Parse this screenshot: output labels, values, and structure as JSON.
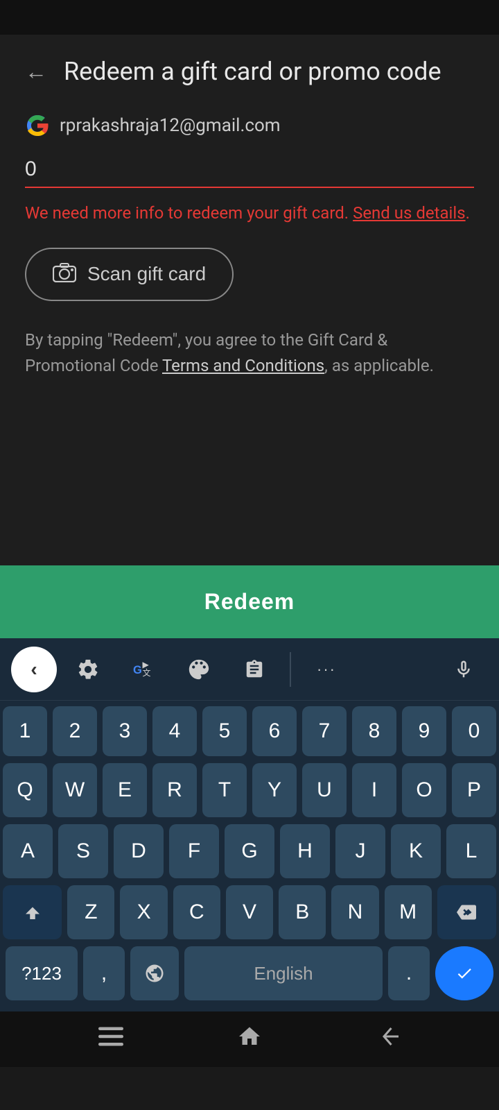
{
  "statusBar": {},
  "header": {
    "back_label": "←",
    "title": "Redeem a gift card or promo code"
  },
  "account": {
    "email": "rprakashraja12@gmail.com"
  },
  "inputField": {
    "value": "0",
    "placeholder": ""
  },
  "error": {
    "message": "We need more info to redeem your gift card. ",
    "link_text": "Send us details",
    "suffix": "."
  },
  "scanButton": {
    "label": "Scan gift card"
  },
  "terms": {
    "text_prefix": "By tapping \"Redeem\", you agree to the Gift Card & Promotional Code ",
    "link_text": "Terms and Conditions",
    "text_suffix": ", as applicable."
  },
  "redeemButton": {
    "label": "Redeem"
  },
  "keyboard": {
    "toolbar": {
      "back_arrow": "‹",
      "gear": "⚙",
      "translate": "G▶",
      "palette": "🎨",
      "clipboard": "📋",
      "more": "···",
      "mic": "🎤"
    },
    "numberRow": [
      "1",
      "2",
      "3",
      "4",
      "5",
      "6",
      "7",
      "8",
      "9",
      "0"
    ],
    "row1": [
      "Q",
      "W",
      "E",
      "R",
      "T",
      "Y",
      "U",
      "I",
      "O",
      "P"
    ],
    "row2": [
      "A",
      "S",
      "D",
      "F",
      "G",
      "H",
      "J",
      "K",
      "L"
    ],
    "row3": [
      "Z",
      "X",
      "C",
      "V",
      "B",
      "N",
      "M"
    ],
    "bottomRow": {
      "num_switch": "?123",
      "comma": ",",
      "globe": "🌐",
      "space": "English",
      "period": ".",
      "enter": "✓"
    }
  },
  "navBar": {
    "menu": "≡",
    "home": "⌂",
    "back": "⟵"
  }
}
